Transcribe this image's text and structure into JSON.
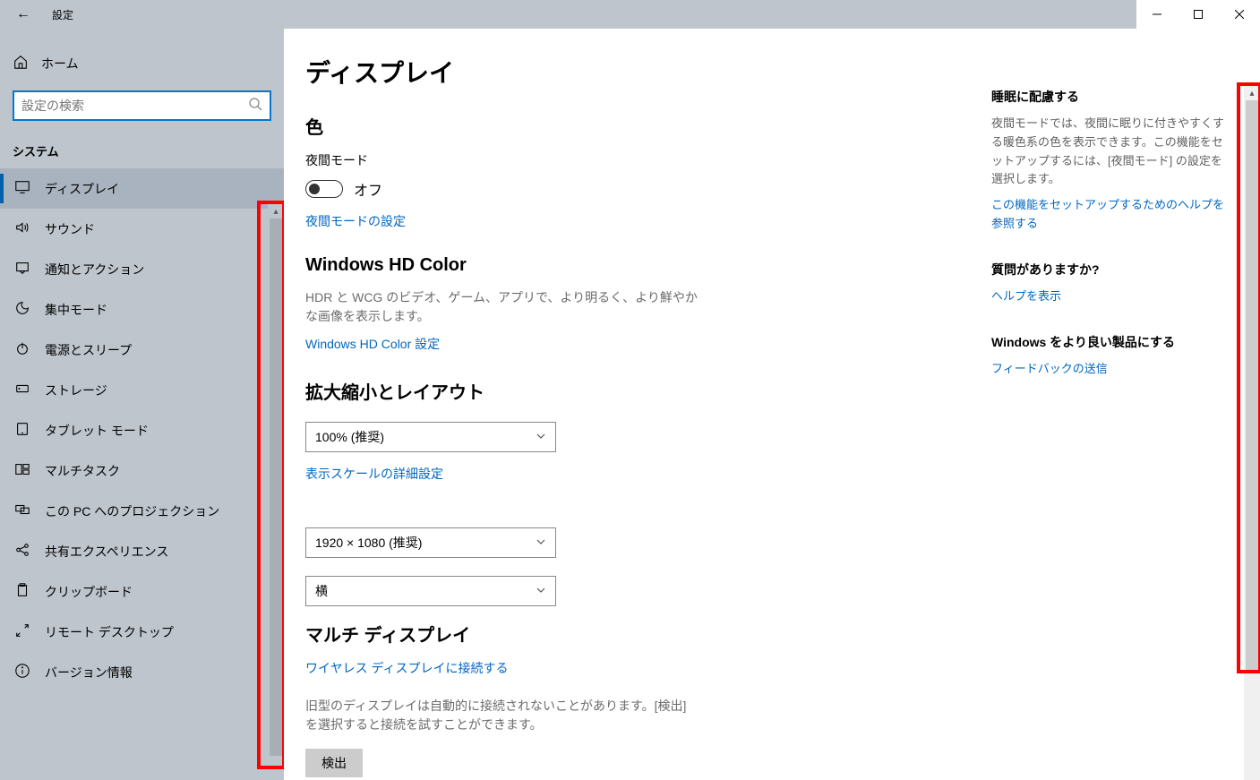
{
  "titlebar": {
    "back": "←",
    "title": "設定"
  },
  "sidebar": {
    "home": "ホーム",
    "search_placeholder": "設定の検索",
    "section": "システム",
    "items": [
      {
        "label": "ディスプレイ",
        "icon": "display",
        "active": true
      },
      {
        "label": "サウンド",
        "icon": "sound"
      },
      {
        "label": "通知とアクション",
        "icon": "notify"
      },
      {
        "label": "集中モード",
        "icon": "focus"
      },
      {
        "label": "電源とスリープ",
        "icon": "power"
      },
      {
        "label": "ストレージ",
        "icon": "storage"
      },
      {
        "label": "タブレット モード",
        "icon": "tablet"
      },
      {
        "label": "マルチタスク",
        "icon": "multitask"
      },
      {
        "label": "この PC へのプロジェクション",
        "icon": "project"
      },
      {
        "label": "共有エクスペリエンス",
        "icon": "share"
      },
      {
        "label": "クリップボード",
        "icon": "clipboard"
      },
      {
        "label": "リモート デスクトップ",
        "icon": "remote"
      },
      {
        "label": "バージョン情報",
        "icon": "about"
      }
    ]
  },
  "main": {
    "title": "ディスプレイ",
    "color_h": "色",
    "night_label": "夜間モード",
    "night_state": "オフ",
    "night_link": "夜間モードの設定",
    "hd_h": "Windows HD Color",
    "hd_desc": "HDR と WCG のビデオ、ゲーム、アプリで、より明るく、より鮮やかな画像を表示します。",
    "hd_link": "Windows HD Color 設定",
    "scale_h": "拡大縮小とレイアウト",
    "scale_value": "100% (推奨)",
    "scale_link": "表示スケールの詳細設定",
    "res_value": "1920 × 1080 (推奨)",
    "orient_value": "横",
    "multi_h": "マルチ ディスプレイ",
    "multi_link": "ワイヤレス ディスプレイに接続する",
    "multi_desc": "旧型のディスプレイは自動的に接続されないことがあります。[検出] を選択すると接続を試すことができます。",
    "detect_btn": "検出"
  },
  "aside": {
    "sleep_h": "睡眠に配慮する",
    "sleep_p": "夜間モードでは、夜間に眠りに付きやすくする暖色系の色を表示できます。この機能をセットアップするには、[夜間モード] の設定を選択します。",
    "sleep_link": "この機能をセットアップするためのヘルプを参照する",
    "q_h": "質問がありますか?",
    "q_link": "ヘルプを表示",
    "fb_h": "Windows をより良い製品にする",
    "fb_link": "フィードバックの送信"
  }
}
